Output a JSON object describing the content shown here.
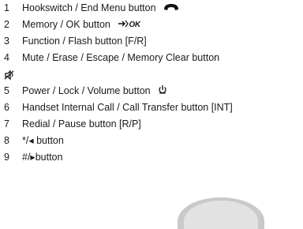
{
  "items": [
    {
      "num": "1",
      "text": "Hookswitch / End Menu button"
    },
    {
      "num": "2",
      "text": "Memory / OK button"
    },
    {
      "num": "3",
      "text": "Function / Flash button [F/R]"
    },
    {
      "num": "4",
      "text": "Mute / Erase / Escape / Memory Clear button"
    },
    {
      "num": "5",
      "text": "Power / Lock / Volume button"
    },
    {
      "num": "6",
      "text": "Handset Internal Call / Call Transfer button [INT]"
    },
    {
      "num": "7",
      "text": "Redial / Pause button [R/P]"
    },
    {
      "num": "8",
      "text": "*/◂ button"
    },
    {
      "num": "9",
      "text": "#/▸button"
    }
  ],
  "icons": {
    "hookswitch": "handset-icon",
    "memory_ok": "memory-ok-icon",
    "mute": "mute-icon",
    "power": "power-icon"
  },
  "memory_ok_label": "OK"
}
